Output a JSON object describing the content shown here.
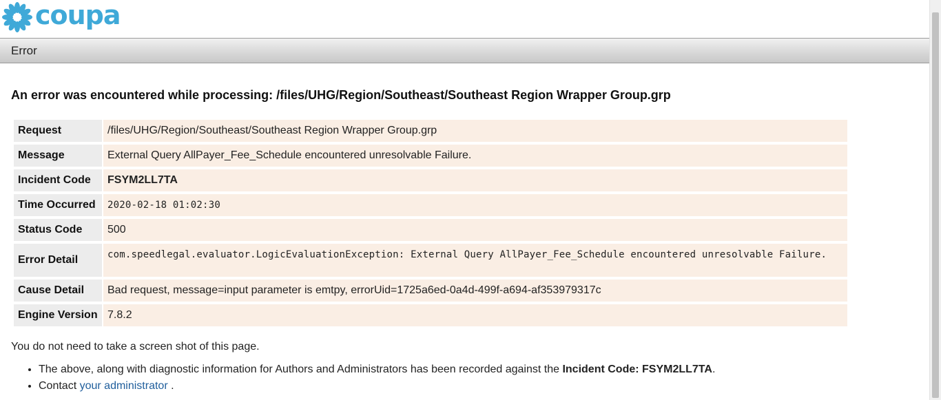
{
  "brand": {
    "name": "coupa",
    "color": "#3fa9d8"
  },
  "title_bar": {
    "title": "Error"
  },
  "heading": "An error was encountered while processing: /files/UHG/Region/Southeast/Southeast Region Wrapper Group.grp",
  "details": {
    "request": {
      "label": "Request",
      "value": "/files/UHG/Region/Southeast/Southeast Region Wrapper Group.grp"
    },
    "message": {
      "label": "Message",
      "value": "External Query AllPayer_Fee_Schedule encountered unresolvable Failure."
    },
    "incident_code": {
      "label": "Incident Code",
      "value": "FSYM2LL7TA"
    },
    "time_occurred": {
      "label": "Time Occurred",
      "value": "2020-02-18 01:02:30"
    },
    "status_code": {
      "label": "Status Code",
      "value": "500"
    },
    "error_detail": {
      "label": "Error Detail",
      "value": "com.speedlegal.evaluator.LogicEvaluationException:  External Query AllPayer_Fee_Schedule encountered unresolvable Failure."
    },
    "cause_detail": {
      "label": "Cause Detail",
      "value": "Bad request, message=input parameter is emtpy, errorUid=1725a6ed-0a4d-499f-a694-af353979317c"
    },
    "engine_version": {
      "label": "Engine Version",
      "value": "7.8.2"
    }
  },
  "note": "You do not need to take a screen shot of this page.",
  "bullets": {
    "recorded_prefix": "The above, along with diagnostic information for Authors and Administrators has been recorded against the ",
    "recorded_code_label": "Incident Code: FSYM2LL7TA",
    "recorded_suffix": ".",
    "contact_prefix": "Contact ",
    "contact_link": "your administrator",
    "contact_suffix": " ."
  }
}
